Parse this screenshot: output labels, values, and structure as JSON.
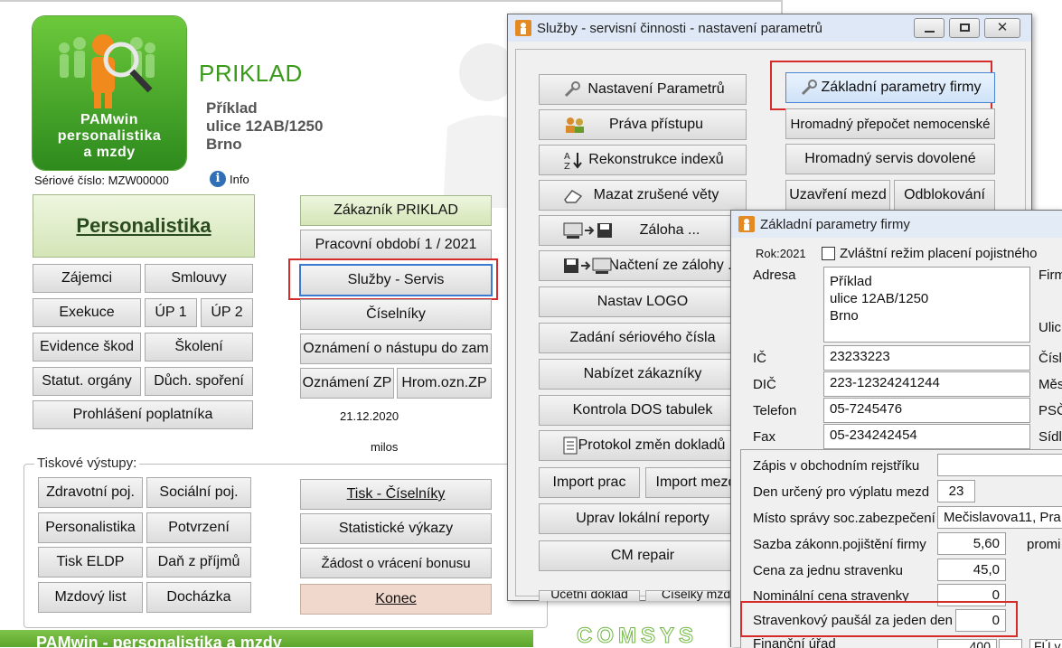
{
  "main": {
    "logo_lines": [
      "PAMwin",
      "personalistika",
      "a mzdy"
    ],
    "company_name": "PRIKLAD",
    "address": [
      "Příklad",
      "ulice 12AB/1250",
      "Brno"
    ],
    "serial_label": "Sériové číslo: MZW00000",
    "info_label": "Info",
    "personalistika": "Personalistika",
    "grid_buttons": [
      "Zájemci",
      "Smlouvy",
      "Exekuce",
      "ÚP 1",
      "ÚP 2",
      "Evidence škod",
      "Školení",
      "Statut. orgány",
      "Důch. spoření",
      "Prohlášení poplatníka"
    ],
    "right_buttons": [
      "Zákazník  PRIKLAD",
      "Pracovní období  1 / 2021",
      "Služby - Servis",
      "Číselníky",
      "Oznámení o nástupu do zam",
      "Oznámení ZP",
      "Hrom.ozn.ZP"
    ],
    "date": "21.12.2020",
    "user": "milos",
    "print_group_title": "Tiskové výstupy:",
    "print_buttons": [
      "Zdravotní poj.",
      "Sociální poj.",
      "Personalistika",
      "Potvrzení",
      "Tisk ELDP",
      "Daň z příjmů",
      "Mzdový list",
      "Docházka"
    ],
    "print_right_buttons": [
      "Tisk - Číselníky",
      "Statistické výkazy",
      "Žádost o vrácení bonusu",
      "Konec"
    ],
    "footer_text": "PAMwin - personalistika a mzdy",
    "footer_brand": "COMSYS"
  },
  "services_dialog": {
    "title": "Služby - servisní činnosti - nastavení parametrů",
    "left_buttons": [
      "Nastavení Parametrů",
      "Práva přístupu",
      "Rekonstrukce indexů",
      "Mazat zrušené věty",
      "Záloha ...",
      "Načtení ze zálohy ...",
      "Nastav LOGO",
      "Zadání sériového čísla",
      "Nabízet zákazníky",
      "Kontrola  DOS tabulek",
      "Protokol změn dokladů",
      "Import prac",
      "Import mezd",
      "Uprav lokální reporty",
      "CM repair"
    ],
    "right_buttons": [
      "Základní parametry firmy",
      "Hromadný přepočet nemocenské",
      "Hromadný servis dovolené",
      "Uzavření mezd",
      "Odblokování"
    ],
    "hidden_buttons": [
      "Účetní doklad",
      "Číselky mzd"
    ]
  },
  "firm_dialog": {
    "title": "Základní parametry firmy",
    "year": "Rok:2021",
    "checkbox_label": "Zvláštní režim placení pojistného",
    "address_label": "Adresa",
    "address_value": [
      "Příklad",
      "ulice 12AB/1250",
      "Brno"
    ],
    "right_labels_top": [
      "Firm",
      "Ulic"
    ],
    "fields": [
      {
        "label": "IČ",
        "value": "23233223",
        "right": "Čísl"
      },
      {
        "label": "DIČ",
        "value": "223-12324241244",
        "right": "Měs"
      },
      {
        "label": "Telefon",
        "value": "05-7245476",
        "right": "PSČ"
      },
      {
        "label": "Fax",
        "value": "05-234242454",
        "right": "Sídl"
      }
    ],
    "rows": [
      {
        "label": "Zápis v obchodním rejstříku",
        "value": ""
      },
      {
        "label": "Den určený pro výplatu mezd",
        "value": "23"
      },
      {
        "label": "Místo správy  soc.zabezpečení",
        "value": "Mečislavova11, Pra"
      },
      {
        "label": "Sazba zákonn.pojištění firmy",
        "value": "5,60",
        "extra": "promi"
      },
      {
        "label": "Cena za jednu stravenku",
        "value": "45,0"
      },
      {
        "label": "Nominální cena stravenky",
        "value": "0"
      },
      {
        "label": "Stravenkový paušál za jeden den",
        "value": "0"
      },
      {
        "label": "Finanční úřad",
        "value": "400",
        "extra": "FÚ v"
      }
    ]
  }
}
